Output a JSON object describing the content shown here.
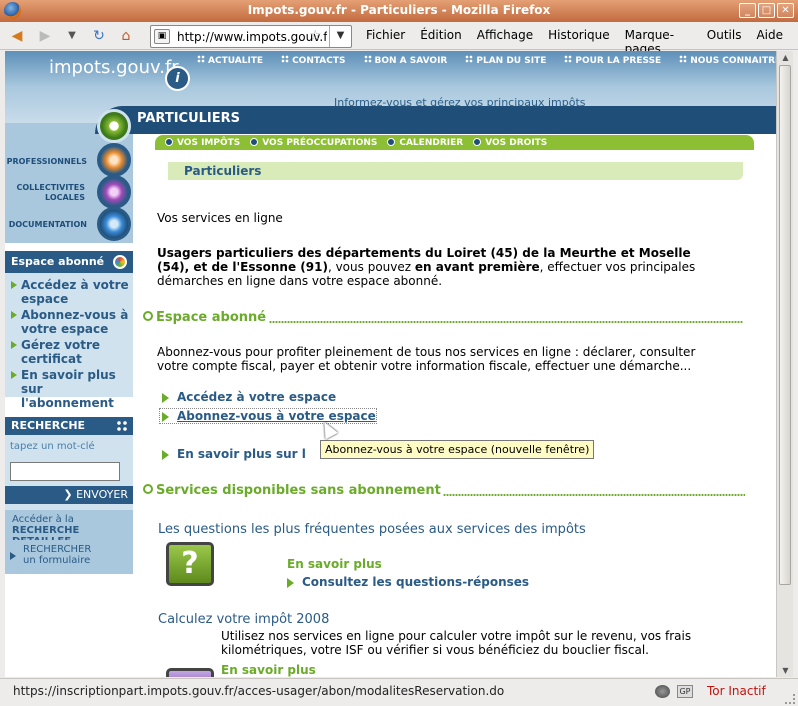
{
  "window": {
    "title": "Impots.gouv.fr - Particuliers - Mozilla Firefox"
  },
  "browser": {
    "url": "http://www.impots.gouv.fr",
    "menu": [
      "Fichier",
      "Édition",
      "Affichage",
      "Historique",
      "Marque-pages",
      "Outils",
      "Aide"
    ],
    "status_text": "https://inscriptionpart.impots.gouv.fr/acces-usager/abon/modalitesReservation.do",
    "status_icon_gp": "GP",
    "tor_status": "Tor Inactif"
  },
  "site": {
    "logo": "impots.gouv.fr",
    "logo_badge": "i",
    "top_nav": [
      "ACTUALITE",
      "CONTACTS",
      "BON A SAVOIR",
      "PLAN DU SITE",
      "POUR LA PRESSE",
      "NOUS CONNAITRE"
    ],
    "tagline": "Informez-vous et gérez vos principaux impôts",
    "section_title": "PARTICULIERS",
    "left_nav": [
      "PROFESSIONNELS",
      "COLLECTIVITES LOCALES",
      "DOCUMENTATION"
    ],
    "green_nav": [
      "VOS IMPÔTS",
      "VOS PRÉOCCUPATIONS",
      "CALENDRIER",
      "VOS DROITS"
    ],
    "breadcrumb": "Particuliers"
  },
  "sidebar": {
    "abonne_title": "Espace abonné",
    "abonne_links": [
      "Accédez à votre espace",
      "Abonnez-vous à votre espace",
      "Gérez votre certificat",
      "En savoir plus sur l'abonnement"
    ],
    "search_title": "RECHERCHE",
    "search_hint": "tapez un mot-clé",
    "search_value": "",
    "envoyer": "ENVOYER",
    "advanced_line1": "Accéder à la",
    "advanced_line2": "RECHERCHE DETAILLEE",
    "form_line1": "RECHERCHER",
    "form_line2": "un formulaire"
  },
  "content": {
    "intro": "Vos services en ligne",
    "notice_bold": "Usagers particuliers des départements du Loiret (45) de la Meurthe et Moselle (54), et de l'Essonne (91)",
    "notice_mid": ", vous pouvez ",
    "notice_bold2": "en avant première",
    "notice_end": ", effectuer vos principales démarches en ligne dans votre espace abonné.",
    "espace_title": "Espace abonné",
    "espace_desc": "Abonnez-vous pour profiter pleinement de tous nos services en ligne : déclarer, consulter votre compte fiscal, payer et obtenir votre information fiscale, effectuer une démarche...",
    "espace_links": [
      "Accédez à votre espace",
      "Abonnez-vous à votre espace",
      "En savoir plus sur l'abonnement"
    ],
    "tooltip": "Abonnez-vous à votre espace (nouvelle fenêtre)",
    "services_title": "Services disponibles sans abonnement",
    "faq_title": "Les questions les plus fréquentes posées aux services des impôts",
    "faq_more": "En savoir plus",
    "faq_link": "Consultez les questions-réponses",
    "calc_title": "Calculez votre impôt 2008",
    "calc_desc": "Utilisez nos services en ligne pour calculer votre impôt sur le revenu, vos frais kilométriques, votre ISF ou vérifier si vous bénéficiez du bouclier fiscal.",
    "calc_more": "En savoir plus"
  }
}
